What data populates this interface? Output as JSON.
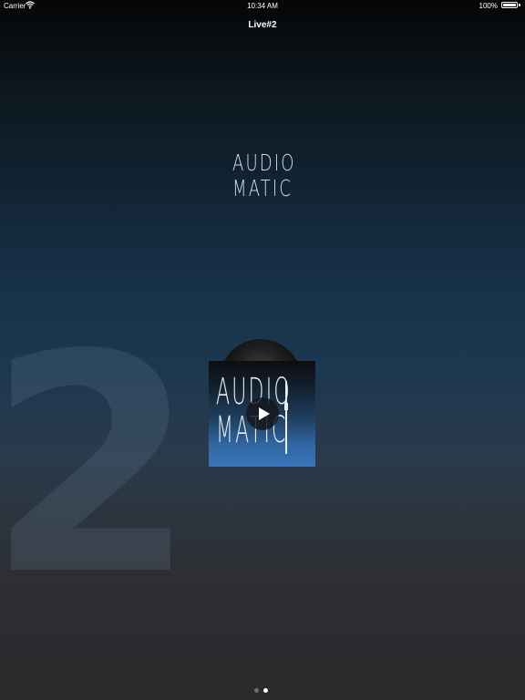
{
  "status_bar": {
    "carrier": "Carrier",
    "time": "10:34 AM",
    "battery": "100%",
    "battery_level": 1.0,
    "wifi_icon": "wifi-icon",
    "battery_icon": "battery-icon"
  },
  "nav": {
    "title": "Live#2"
  },
  "logo": {
    "line1": "AUDIO",
    "line2": "MATIC"
  },
  "background_number": "2",
  "album": {
    "line1": "AUDIO",
    "line2": "MATIC",
    "play_icon": "play-icon"
  },
  "pager": {
    "count": 2,
    "active_index": 1
  },
  "colors": {
    "background_top": "#050607",
    "background_mid": "#163047",
    "background_bottom": "#2a2a2c",
    "cover_blue": "#3a75b8"
  }
}
